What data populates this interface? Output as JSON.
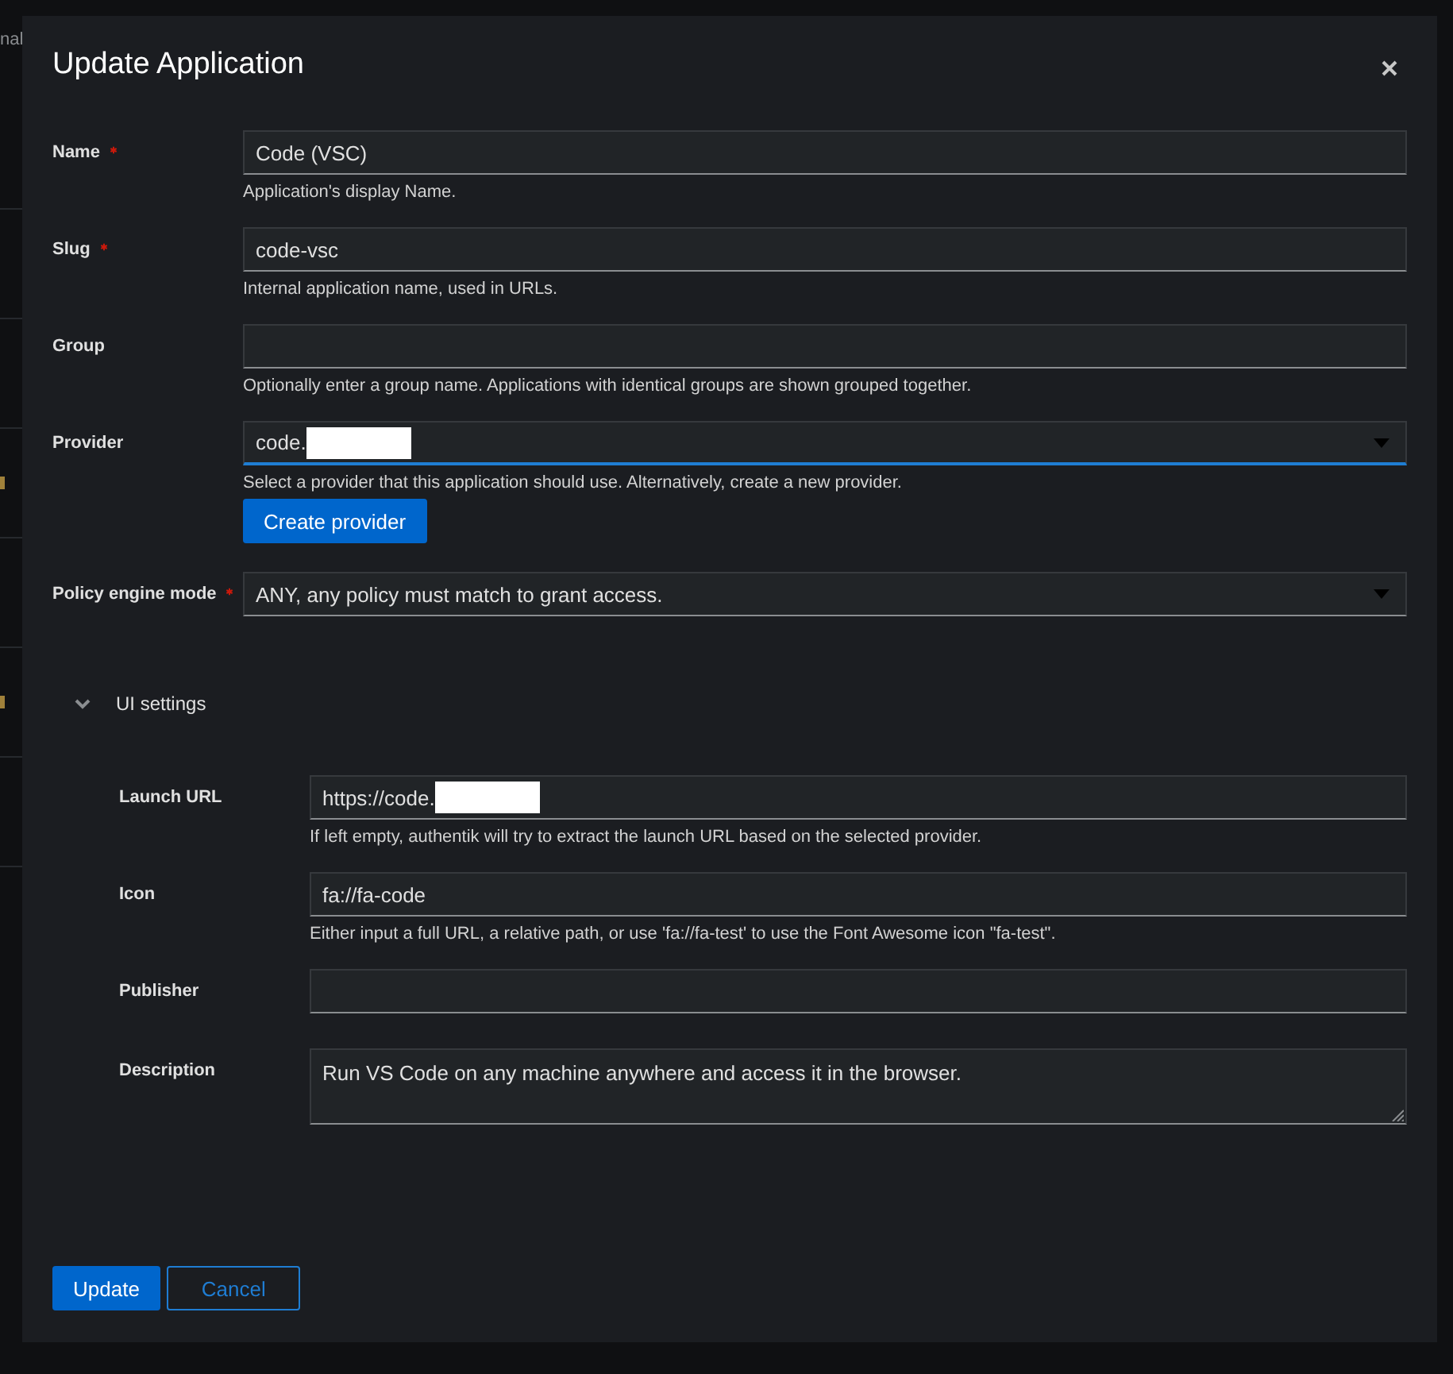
{
  "background": {
    "subtitle": "nal"
  },
  "modal": {
    "title": "Update Application",
    "fields": [
      {
        "kind": "text",
        "label": "Name",
        "required": true,
        "value": "Code (VSC)",
        "helper": "Application's display Name."
      },
      {
        "kind": "text",
        "label": "Slug",
        "required": true,
        "value": "code-vsc",
        "helper": "Internal application name, used in URLs."
      },
      {
        "kind": "text",
        "label": "Group",
        "required": false,
        "helper": "Optionally enter a group name. Applications with identical groups are shown grouped together."
      },
      {
        "kind": "select",
        "label": "Provider",
        "required": false,
        "value": "code.",
        "redacted": true,
        "focused": true,
        "helper": "Select a provider that this application should use. Alternatively, create a new provider.",
        "action": "Create provider"
      },
      {
        "kind": "select",
        "label": "Policy engine mode",
        "required": true,
        "value": "ANY, any policy must match to grant access."
      }
    ],
    "section": {
      "label": "UI settings",
      "expanded": true,
      "fields": [
        {
          "kind": "text",
          "label": "Launch URL",
          "value": "https://code.",
          "redacted": true,
          "helper": "If left empty, authentik will try to extract the launch URL based on the selected provider."
        },
        {
          "kind": "text",
          "label": "Icon",
          "value": "fa://fa-code",
          "helper": "Either input a full URL, a relative path, or use 'fa://fa-test' to use the Font Awesome icon \"fa-test\"."
        },
        {
          "kind": "text",
          "label": "Publisher"
        },
        {
          "kind": "textarea",
          "label": "Description",
          "value": "Run VS Code on any machine anywhere and access it in the browser."
        }
      ]
    },
    "buttons": [
      {
        "label": "Update",
        "kind": "primary"
      },
      {
        "label": "Cancel",
        "kind": "secondary"
      }
    ]
  }
}
